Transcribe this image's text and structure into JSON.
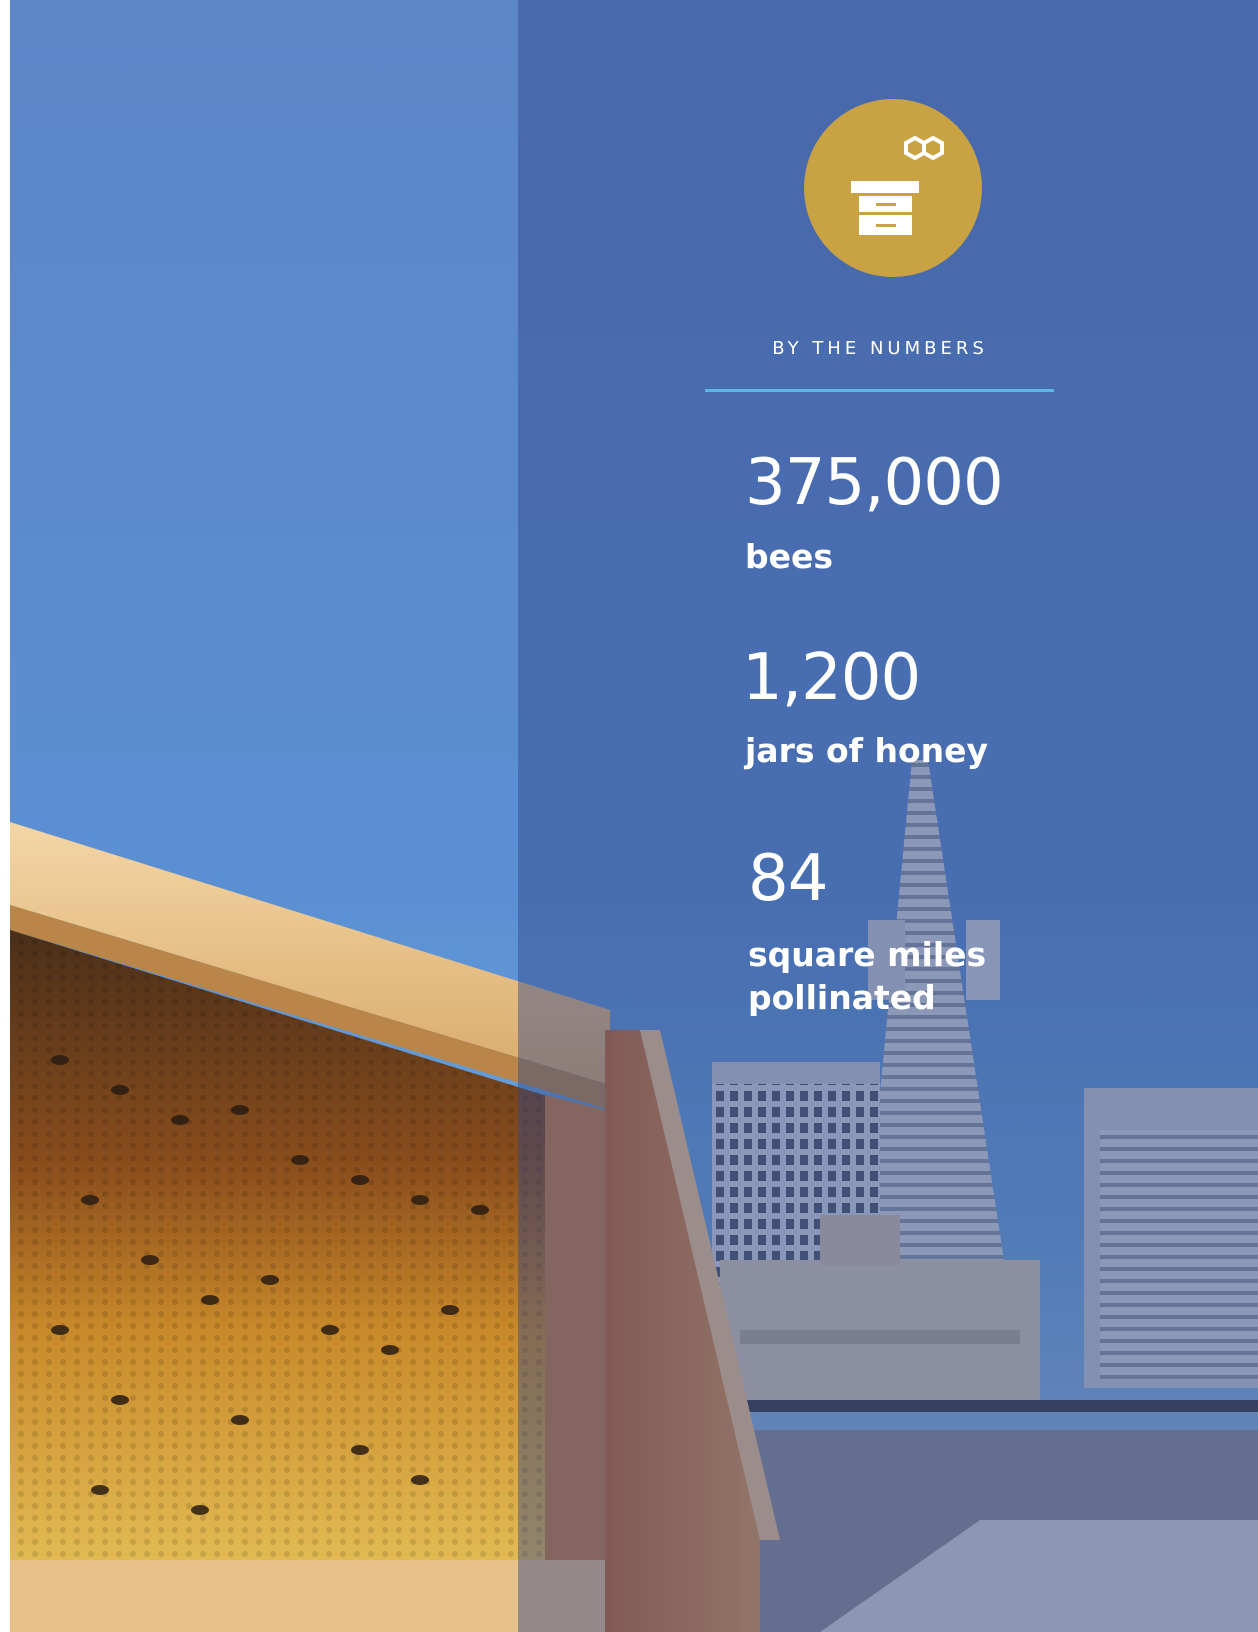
{
  "header": {
    "section_label": "BY THE NUMBERS",
    "badge_icon": "beehive-honeycomb-icon"
  },
  "stats": [
    {
      "value": "375,000",
      "label": "bees"
    },
    {
      "value": "1,200",
      "label": "jars of honey"
    },
    {
      "value": "84",
      "label": "square miles pollinated"
    }
  ],
  "colors": {
    "badge": "#c9a343",
    "divider": "#5bb8e6",
    "overlay": "#30488a",
    "text": "#ffffff"
  }
}
